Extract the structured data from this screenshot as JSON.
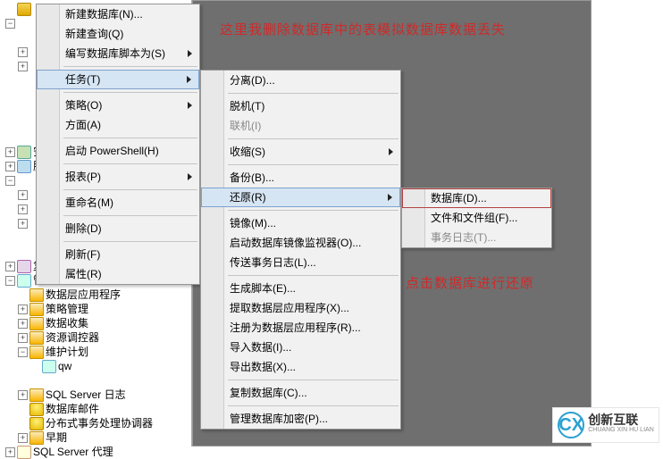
{
  "annotations": {
    "top_note": "这里我删除数据库中的表模拟数据库数据丢失",
    "bottom_note": "点击数据库进行还原"
  },
  "tree": {
    "nodes": [
      {
        "toggle": "",
        "icon": "db",
        "label": "",
        "depth": 0
      },
      {
        "toggle": "−",
        "icon": "",
        "label": "",
        "depth": 0
      },
      {
        "toggle": "",
        "icon": "",
        "label": "",
        "depth": 1
      },
      {
        "toggle": "+",
        "icon": "",
        "label": "",
        "depth": 1
      },
      {
        "toggle": "+",
        "icon": "",
        "label": "",
        "depth": 1
      },
      {
        "toggle": "",
        "icon": "",
        "label": "",
        "depth": 1
      },
      {
        "toggle": "",
        "icon": "",
        "label": "",
        "depth": 1
      },
      {
        "toggle": "",
        "icon": "",
        "label": "",
        "depth": 1
      },
      {
        "toggle": "",
        "icon": "",
        "label": "",
        "depth": 1
      },
      {
        "toggle": "",
        "icon": "",
        "label": "",
        "depth": 1
      },
      {
        "toggle": "+",
        "icon": "sec",
        "label": "安",
        "depth": 0
      },
      {
        "toggle": "+",
        "icon": "obj",
        "label": "服",
        "depth": 0
      },
      {
        "toggle": "−",
        "icon": "",
        "label": "",
        "depth": 0
      },
      {
        "toggle": "+",
        "icon": "",
        "label": "",
        "depth": 1
      },
      {
        "toggle": "+",
        "icon": "",
        "label": "",
        "depth": 1
      },
      {
        "toggle": "+",
        "icon": "",
        "label": "",
        "depth": 1
      },
      {
        "toggle": "",
        "icon": "",
        "label": "",
        "depth": 1
      },
      {
        "toggle": "",
        "icon": "",
        "label": "",
        "depth": 1
      },
      {
        "toggle": "+",
        "icon": "rep",
        "label": "复",
        "depth": 0
      },
      {
        "toggle": "−",
        "icon": "mgmt",
        "label": "管",
        "depth": 0
      },
      {
        "toggle": "",
        "icon": "folder",
        "label": "数据层应用程序",
        "depth": 1
      },
      {
        "toggle": "+",
        "icon": "folder",
        "label": "策略管理",
        "depth": 1
      },
      {
        "toggle": "+",
        "icon": "folder",
        "label": "数据收集",
        "depth": 1
      },
      {
        "toggle": "+",
        "icon": "folder",
        "label": "资源调控器",
        "depth": 1
      },
      {
        "toggle": "−",
        "icon": "folder",
        "label": "维护计划",
        "depth": 1
      },
      {
        "toggle": "",
        "icon": "mgmt",
        "label": "qw",
        "depth": 2
      },
      {
        "toggle": "",
        "icon": "",
        "label": "",
        "depth": 1
      },
      {
        "toggle": "+",
        "icon": "folder",
        "label": "SQL Server 日志",
        "depth": 1
      },
      {
        "toggle": "",
        "icon": "cyl",
        "label": "数据库邮件",
        "depth": 1
      },
      {
        "toggle": "",
        "icon": "cyl",
        "label": "分布式事务处理协调器",
        "depth": 1
      },
      {
        "toggle": "+",
        "icon": "folder",
        "label": "早期",
        "depth": 1
      },
      {
        "toggle": "+",
        "icon": "agent",
        "label": "SQL Server 代理",
        "depth": 0
      }
    ]
  },
  "menu1": {
    "items": [
      {
        "label": "新建数据库(N)...",
        "submenu": false,
        "sep": false
      },
      {
        "label": "新建查询(Q)",
        "submenu": false,
        "sep": false
      },
      {
        "label": "编写数据库脚本为(S)",
        "submenu": true,
        "sep": false
      },
      {
        "sep": true
      },
      {
        "label": "任务(T)",
        "submenu": true,
        "sep": false,
        "highlight": true
      },
      {
        "sep": true
      },
      {
        "label": "策略(O)",
        "submenu": true,
        "sep": false
      },
      {
        "label": "方面(A)",
        "submenu": false,
        "sep": false
      },
      {
        "sep": true
      },
      {
        "label": "启动 PowerShell(H)",
        "submenu": false,
        "sep": false
      },
      {
        "sep": true
      },
      {
        "label": "报表(P)",
        "submenu": true,
        "sep": false
      },
      {
        "sep": true
      },
      {
        "label": "重命名(M)",
        "submenu": false,
        "sep": false
      },
      {
        "sep": true
      },
      {
        "label": "删除(D)",
        "submenu": false,
        "sep": false
      },
      {
        "sep": true
      },
      {
        "label": "刷新(F)",
        "submenu": false,
        "sep": false
      },
      {
        "label": "属性(R)",
        "submenu": false,
        "sep": false
      }
    ]
  },
  "menu2": {
    "items": [
      {
        "label": "分离(D)...",
        "sep": false
      },
      {
        "sep": true
      },
      {
        "label": "脱机(T)",
        "sep": false
      },
      {
        "label": "联机(I)",
        "sep": false,
        "disabled": true
      },
      {
        "sep": true
      },
      {
        "label": "收缩(S)",
        "submenu": true,
        "sep": false
      },
      {
        "sep": true
      },
      {
        "label": "备份(B)...",
        "sep": false
      },
      {
        "label": "还原(R)",
        "submenu": true,
        "sep": false,
        "highlight": true
      },
      {
        "sep": true
      },
      {
        "label": "镜像(M)...",
        "sep": false
      },
      {
        "label": "启动数据库镜像监视器(O)...",
        "sep": false
      },
      {
        "label": "传送事务日志(L)...",
        "sep": false
      },
      {
        "sep": true
      },
      {
        "label": "生成脚本(E)...",
        "sep": false
      },
      {
        "label": "提取数据层应用程序(X)...",
        "sep": false
      },
      {
        "label": "注册为数据层应用程序(R)...",
        "sep": false
      },
      {
        "label": "导入数据(I)...",
        "sep": false
      },
      {
        "label": "导出数据(X)...",
        "sep": false
      },
      {
        "sep": true
      },
      {
        "label": "复制数据库(C)...",
        "sep": false
      },
      {
        "sep": true
      },
      {
        "label": "管理数据库加密(P)...",
        "sep": false
      }
    ]
  },
  "menu3": {
    "items": [
      {
        "label": "数据库(D)...",
        "boxed": true
      },
      {
        "label": "文件和文件组(F)..."
      },
      {
        "label": "事务日志(T)...",
        "disabled": true
      }
    ]
  },
  "logo": {
    "mark": "CX",
    "title": "创新互联",
    "sub": "CHUANG XIN HU LIAN"
  }
}
